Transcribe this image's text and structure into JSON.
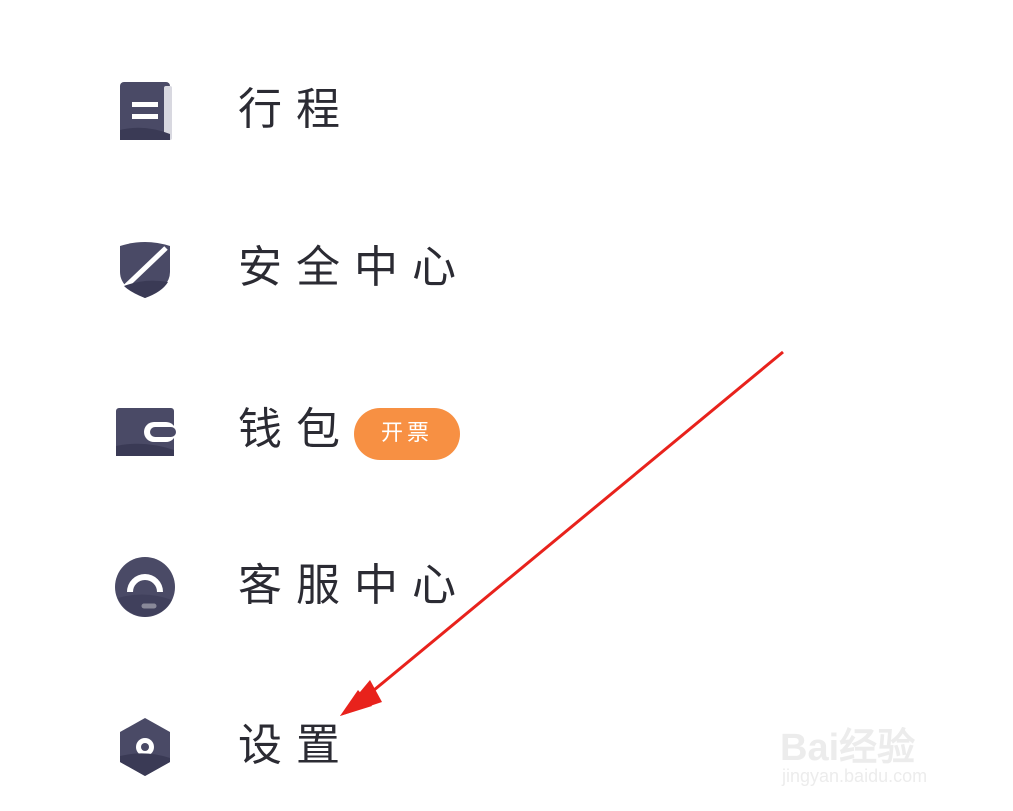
{
  "menu": {
    "items": [
      {
        "label": "行程",
        "icon": "document-icon"
      },
      {
        "label": "安全中心",
        "icon": "shield-icon"
      },
      {
        "label": "钱包",
        "icon": "wallet-icon",
        "badge": "开票"
      },
      {
        "label": "客服中心",
        "icon": "headset-icon"
      },
      {
        "label": "设置",
        "icon": "gear-icon"
      }
    ]
  },
  "colors": {
    "icon": "#4a4a66",
    "text": "#2b2b33",
    "badge": "#f79043",
    "arrow": "#e8221c"
  },
  "watermark": {
    "brand": "Bai经验",
    "url": "jingyan.baidu.com"
  }
}
